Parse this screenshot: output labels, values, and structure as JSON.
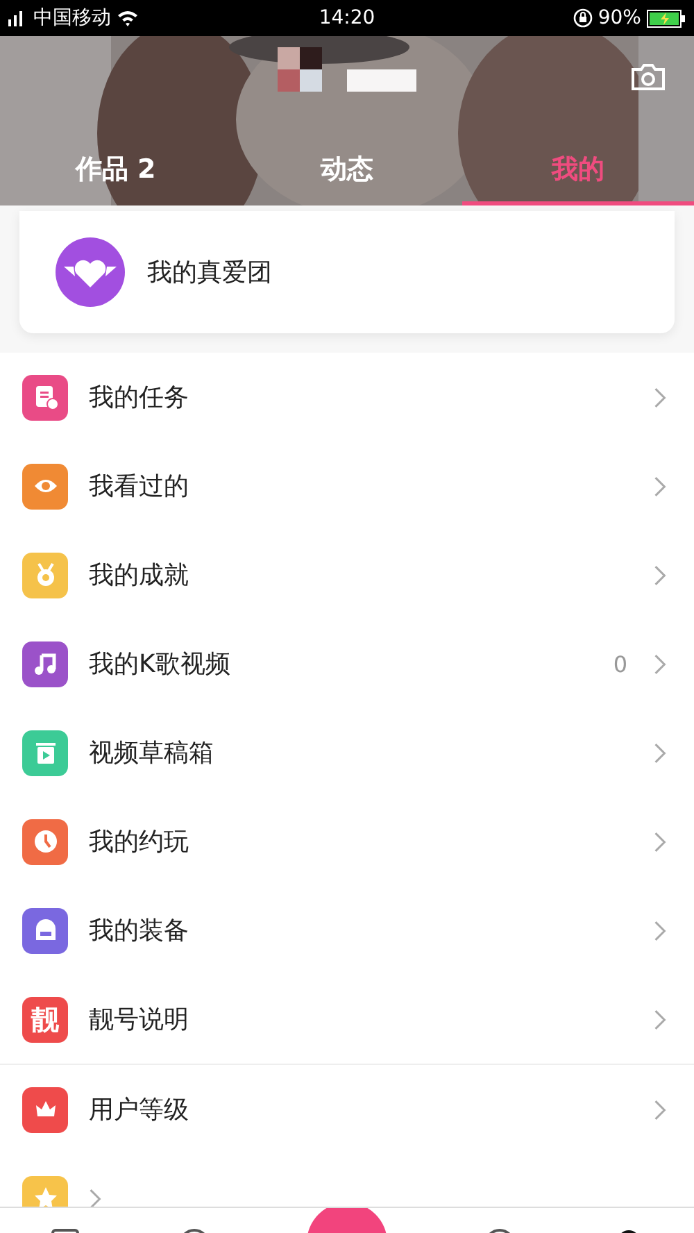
{
  "status_bar": {
    "carrier": "中国移动",
    "time": "14:20",
    "battery": "90%"
  },
  "tabs": [
    {
      "label": "作品 2",
      "selected": false
    },
    {
      "label": "动态",
      "selected": false
    },
    {
      "label": "我的",
      "selected": true
    }
  ],
  "fan_club": {
    "label": "我的真爱团"
  },
  "menu": [
    {
      "kind": "task",
      "label": "我的任务",
      "color": "#e94b86"
    },
    {
      "kind": "eye",
      "label": "我看过的",
      "color": "#f08a34"
    },
    {
      "kind": "medal",
      "label": "我的成就",
      "color": "#f5c24a"
    },
    {
      "kind": "music",
      "label": "我的K歌视频",
      "color": "#9b52c9",
      "count": "0"
    },
    {
      "kind": "trash",
      "label": "视频草稿箱",
      "color": "#3ccb96"
    },
    {
      "kind": "clock",
      "label": "我的约玩",
      "color": "#f06b45"
    },
    {
      "kind": "bag",
      "label": "我的装备",
      "color": "#7a68e0"
    },
    {
      "kind": "char",
      "label": "靓号说明",
      "color": "#ee4b4b",
      "glyph": "靓"
    }
  ],
  "menu2": [
    {
      "kind": "crown",
      "label": "用户等级",
      "color": "#ef4b4b"
    },
    {
      "kind": "star",
      "color": "#f7c34a"
    }
  ]
}
